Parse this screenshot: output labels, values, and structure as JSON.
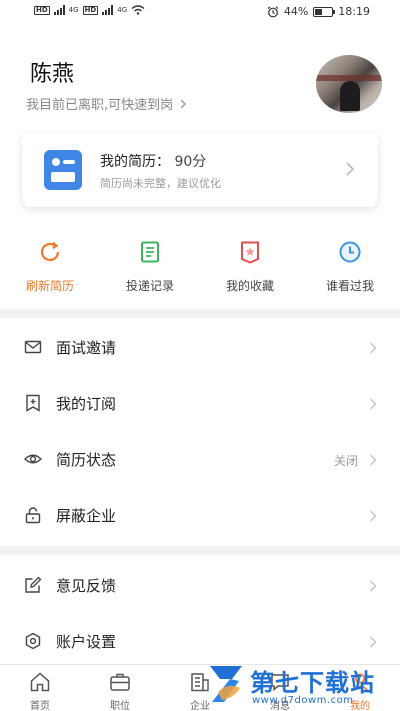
{
  "status_bar": {
    "sim1": "HD",
    "sim2": "HD",
    "net1": "4G",
    "net2": "4G",
    "battery": "44%",
    "battery_level": 0.44,
    "time": "18:19"
  },
  "header": {
    "name": "陈燕",
    "job_status": "我目前已离职,可快速到岗"
  },
  "resume_card": {
    "title": "我的简历：",
    "score": "90分",
    "subtitle": "简历尚未完整，建议优化"
  },
  "quick_actions": [
    {
      "label": "刷新简历",
      "icon": "refresh-icon",
      "color": "#f07a2a"
    },
    {
      "label": "投递记录",
      "icon": "record-icon",
      "color": "#3cb45a"
    },
    {
      "label": "我的收藏",
      "icon": "favorite-icon",
      "color": "#e0504f"
    },
    {
      "label": "谁看过我",
      "icon": "clock-icon",
      "color": "#3b96db"
    }
  ],
  "menu": {
    "group1": [
      {
        "label": "面试邀请",
        "icon": "mail-icon",
        "value": ""
      },
      {
        "label": "我的订阅",
        "icon": "bookmark-icon",
        "value": ""
      },
      {
        "label": "简历状态",
        "icon": "eye-icon",
        "value": "关闭"
      },
      {
        "label": "屏蔽企业",
        "icon": "lock-icon",
        "value": ""
      }
    ],
    "group2": [
      {
        "label": "意见反馈",
        "icon": "edit-icon",
        "value": ""
      },
      {
        "label": "账户设置",
        "icon": "gear-icon",
        "value": ""
      }
    ]
  },
  "bottom_nav": [
    {
      "label": "首页",
      "icon": "home-icon"
    },
    {
      "label": "职位",
      "icon": "briefcase-icon"
    },
    {
      "label": "企业",
      "icon": "building-icon"
    },
    {
      "label": "消息",
      "icon": "message-icon"
    },
    {
      "label": "我的",
      "icon": "user-icon"
    }
  ],
  "watermark": {
    "text": "第七下载站",
    "url": "www.d7dowm.com"
  },
  "colors": {
    "accent": "#f07a2a",
    "resume_blue": "#3f86e6",
    "watermark_blue": "#1f6fd6"
  }
}
